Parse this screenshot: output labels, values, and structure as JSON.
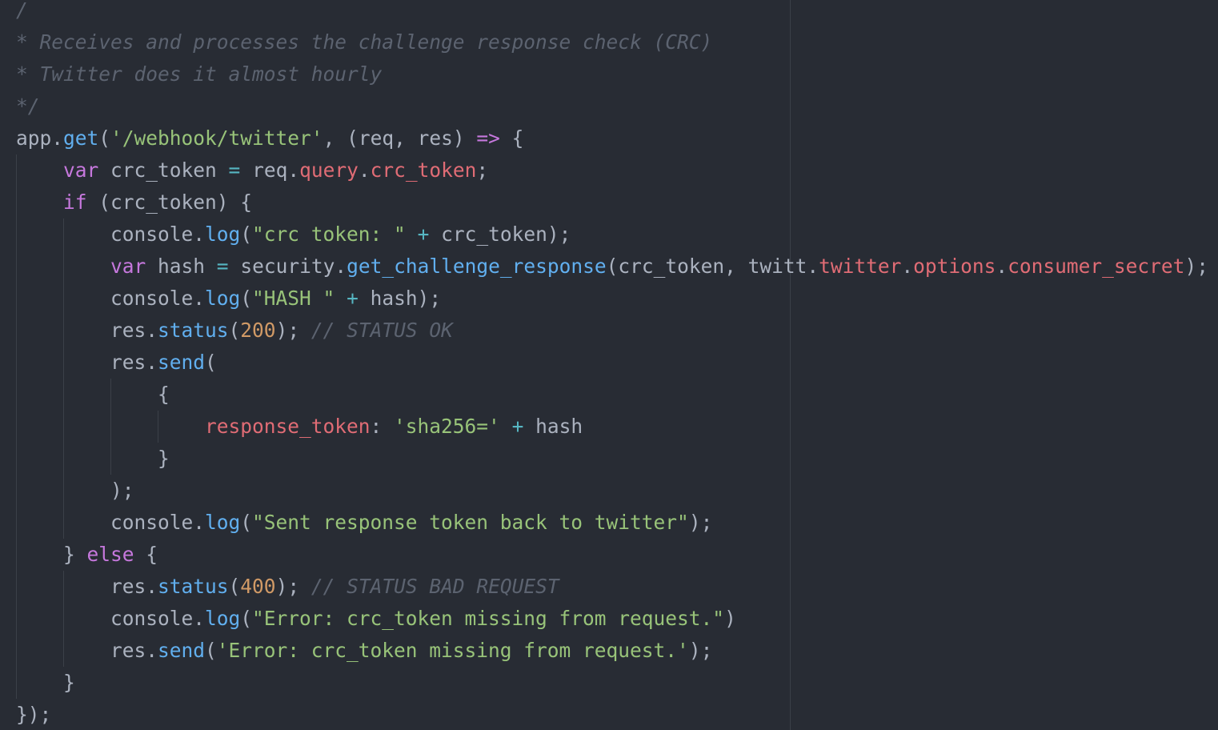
{
  "colors": {
    "background": "#282c34",
    "plain": "#abb2bf",
    "comment": "#5c6370",
    "function": "#61afef",
    "string": "#98c379",
    "keyword": "#c678dd",
    "property": "#e06c75",
    "operator": "#56b6c2",
    "number": "#d19a66"
  },
  "code": {
    "lines": [
      {
        "guides": [],
        "tokens": [
          {
            "t": "comment",
            "v": "/"
          }
        ]
      },
      {
        "guides": [],
        "tokens": [
          {
            "t": "comment",
            "v": "* Receives and processes the challenge response check (CRC)"
          }
        ]
      },
      {
        "guides": [],
        "tokens": [
          {
            "t": "comment",
            "v": "* Twitter does it almost hourly"
          }
        ]
      },
      {
        "guides": [],
        "tokens": [
          {
            "t": "comment",
            "v": "*/"
          }
        ]
      },
      {
        "guides": [],
        "tokens": [
          {
            "t": "plain",
            "v": "app."
          },
          {
            "t": "func",
            "v": "get"
          },
          {
            "t": "plain",
            "v": "("
          },
          {
            "t": "string",
            "v": "'/webhook/twitter'"
          },
          {
            "t": "plain",
            "v": ", (req, res) "
          },
          {
            "t": "keyword",
            "v": "=>"
          },
          {
            "t": "plain",
            "v": " {"
          }
        ]
      },
      {
        "guides": [
          0
        ],
        "tokens": [
          {
            "t": "plain",
            "v": "    "
          },
          {
            "t": "keyword",
            "v": "var"
          },
          {
            "t": "plain",
            "v": " crc_token "
          },
          {
            "t": "op",
            "v": "="
          },
          {
            "t": "plain",
            "v": " req."
          },
          {
            "t": "prop",
            "v": "query"
          },
          {
            "t": "plain",
            "v": "."
          },
          {
            "t": "prop",
            "v": "crc_token"
          },
          {
            "t": "plain",
            "v": ";"
          }
        ]
      },
      {
        "guides": [
          0
        ],
        "tokens": [
          {
            "t": "plain",
            "v": "    "
          },
          {
            "t": "keyword",
            "v": "if"
          },
          {
            "t": "plain",
            "v": " (crc_token) {"
          }
        ]
      },
      {
        "guides": [
          0,
          4
        ],
        "tokens": [
          {
            "t": "plain",
            "v": "        console."
          },
          {
            "t": "func",
            "v": "log"
          },
          {
            "t": "plain",
            "v": "("
          },
          {
            "t": "string",
            "v": "\"crc token: \""
          },
          {
            "t": "plain",
            "v": " "
          },
          {
            "t": "op",
            "v": "+"
          },
          {
            "t": "plain",
            "v": " crc_token);"
          }
        ]
      },
      {
        "guides": [
          0,
          4
        ],
        "tokens": [
          {
            "t": "plain",
            "v": "        "
          },
          {
            "t": "keyword",
            "v": "var"
          },
          {
            "t": "plain",
            "v": " hash "
          },
          {
            "t": "op",
            "v": "="
          },
          {
            "t": "plain",
            "v": " security."
          },
          {
            "t": "func",
            "v": "get_challenge_response"
          },
          {
            "t": "plain",
            "v": "(crc_token, twitt."
          },
          {
            "t": "prop",
            "v": "twitter"
          },
          {
            "t": "plain",
            "v": "."
          },
          {
            "t": "prop",
            "v": "options"
          },
          {
            "t": "plain",
            "v": "."
          },
          {
            "t": "prop",
            "v": "consumer_secret"
          },
          {
            "t": "plain",
            "v": ");"
          }
        ]
      },
      {
        "guides": [
          0,
          4
        ],
        "tokens": [
          {
            "t": "plain",
            "v": "        console."
          },
          {
            "t": "func",
            "v": "log"
          },
          {
            "t": "plain",
            "v": "("
          },
          {
            "t": "string",
            "v": "\"HASH \""
          },
          {
            "t": "plain",
            "v": " "
          },
          {
            "t": "op",
            "v": "+"
          },
          {
            "t": "plain",
            "v": " hash);"
          }
        ]
      },
      {
        "guides": [
          0,
          4
        ],
        "tokens": [
          {
            "t": "plain",
            "v": "        res."
          },
          {
            "t": "func",
            "v": "status"
          },
          {
            "t": "plain",
            "v": "("
          },
          {
            "t": "number",
            "v": "200"
          },
          {
            "t": "plain",
            "v": "); "
          },
          {
            "t": "comment",
            "v": "// STATUS OK"
          }
        ]
      },
      {
        "guides": [
          0,
          4
        ],
        "tokens": [
          {
            "t": "plain",
            "v": "        res."
          },
          {
            "t": "func",
            "v": "send"
          },
          {
            "t": "plain",
            "v": "("
          }
        ]
      },
      {
        "guides": [
          0,
          4,
          8
        ],
        "tokens": [
          {
            "t": "plain",
            "v": "            {"
          }
        ]
      },
      {
        "guides": [
          0,
          4,
          8,
          12
        ],
        "tokens": [
          {
            "t": "plain",
            "v": "                "
          },
          {
            "t": "prop",
            "v": "response_token"
          },
          {
            "t": "plain",
            "v": ": "
          },
          {
            "t": "string",
            "v": "'sha256='"
          },
          {
            "t": "plain",
            "v": " "
          },
          {
            "t": "op",
            "v": "+"
          },
          {
            "t": "plain",
            "v": " hash"
          }
        ]
      },
      {
        "guides": [
          0,
          4,
          8
        ],
        "tokens": [
          {
            "t": "plain",
            "v": "            }"
          }
        ]
      },
      {
        "guides": [
          0,
          4
        ],
        "tokens": [
          {
            "t": "plain",
            "v": "        );"
          }
        ]
      },
      {
        "guides": [
          0,
          4
        ],
        "tokens": [
          {
            "t": "plain",
            "v": "        console."
          },
          {
            "t": "func",
            "v": "log"
          },
          {
            "t": "plain",
            "v": "("
          },
          {
            "t": "string",
            "v": "\"Sent response token back to twitter\""
          },
          {
            "t": "plain",
            "v": ");"
          }
        ]
      },
      {
        "guides": [
          0
        ],
        "tokens": [
          {
            "t": "plain",
            "v": "    } "
          },
          {
            "t": "keyword",
            "v": "else"
          },
          {
            "t": "plain",
            "v": " {"
          }
        ]
      },
      {
        "guides": [
          0,
          4
        ],
        "tokens": [
          {
            "t": "plain",
            "v": "        res."
          },
          {
            "t": "func",
            "v": "status"
          },
          {
            "t": "plain",
            "v": "("
          },
          {
            "t": "number",
            "v": "400"
          },
          {
            "t": "plain",
            "v": "); "
          },
          {
            "t": "comment",
            "v": "// STATUS BAD REQUEST"
          }
        ]
      },
      {
        "guides": [
          0,
          4
        ],
        "tokens": [
          {
            "t": "plain",
            "v": "        console."
          },
          {
            "t": "func",
            "v": "log"
          },
          {
            "t": "plain",
            "v": "("
          },
          {
            "t": "string",
            "v": "\"Error: crc_token missing from request.\""
          },
          {
            "t": "plain",
            "v": ")"
          }
        ]
      },
      {
        "guides": [
          0,
          4
        ],
        "tokens": [
          {
            "t": "plain",
            "v": "        res."
          },
          {
            "t": "func",
            "v": "send"
          },
          {
            "t": "plain",
            "v": "("
          },
          {
            "t": "string",
            "v": "'Error: crc_token missing from request.'"
          },
          {
            "t": "plain",
            "v": ");"
          }
        ]
      },
      {
        "guides": [
          0
        ],
        "tokens": [
          {
            "t": "plain",
            "v": "    }"
          }
        ]
      },
      {
        "guides": [],
        "tokens": [
          {
            "t": "plain",
            "v": "});"
          }
        ]
      }
    ]
  }
}
